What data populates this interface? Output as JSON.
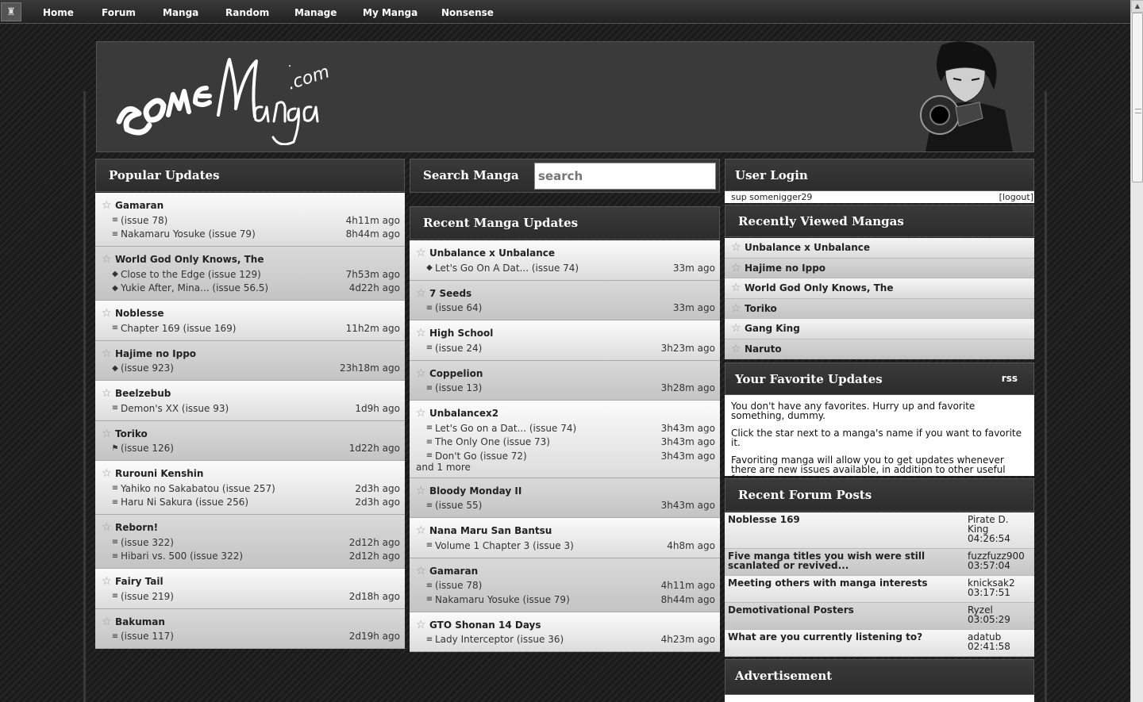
{
  "nav": {
    "items": [
      "Home",
      "Forum",
      "Manga",
      "Random",
      "Manage",
      "My Manga",
      "Nonsense"
    ]
  },
  "brand": {
    "logo_text": "someManga.com"
  },
  "popular": {
    "title": "Popular Updates",
    "entries": [
      {
        "name": "Gamaran",
        "lines": [
          {
            "icon": "book",
            "text": "(issue 78)",
            "ago": "4h11m ago"
          },
          {
            "icon": "book",
            "text": "Nakamaru Yosuke (issue 79)",
            "ago": "8h44m ago"
          }
        ]
      },
      {
        "name": "World God Only Knows, The",
        "lines": [
          {
            "icon": "diamond",
            "text": "Close to the Edge (issue 129)",
            "ago": "7h53m ago"
          },
          {
            "icon": "diamond",
            "text": "Yukie After, Mina... (issue 56.5)",
            "ago": "4d22h ago"
          }
        ]
      },
      {
        "name": "Noblesse",
        "lines": [
          {
            "icon": "book",
            "text": "Chapter 169 (issue 169)",
            "ago": "11h2m ago"
          }
        ]
      },
      {
        "name": "Hajime no Ippo",
        "lines": [
          {
            "icon": "diamond",
            "text": "(issue 923)",
            "ago": "23h18m ago"
          }
        ]
      },
      {
        "name": "Beelzebub",
        "lines": [
          {
            "icon": "book",
            "text": "Demon's XX (issue 93)",
            "ago": "1d9h ago"
          }
        ]
      },
      {
        "name": "Toriko",
        "lines": [
          {
            "icon": "flag",
            "text": "(issue 126)",
            "ago": "1d22h ago"
          }
        ]
      },
      {
        "name": "Rurouni Kenshin",
        "lines": [
          {
            "icon": "book",
            "text": "Yahiko no Sakabatou (issue 257)",
            "ago": "2d3h ago"
          },
          {
            "icon": "book",
            "text": "Haru Ni Sakura (issue 256)",
            "ago": "2d3h ago"
          }
        ]
      },
      {
        "name": "Reborn!",
        "lines": [
          {
            "icon": "book",
            "text": "(issue 322)",
            "ago": "2d12h ago"
          },
          {
            "icon": "book",
            "text": "Hibari vs. 500 (issue 322)",
            "ago": "2d12h ago"
          }
        ]
      },
      {
        "name": "Fairy Tail",
        "lines": [
          {
            "icon": "book",
            "text": "(issue 219)",
            "ago": "2d18h ago"
          }
        ]
      },
      {
        "name": "Bakuman",
        "lines": [
          {
            "icon": "book",
            "text": "(issue 117)",
            "ago": "2d19h ago"
          }
        ]
      }
    ]
  },
  "search": {
    "title": "Search Manga",
    "placeholder": "search"
  },
  "recent": {
    "title": "Recent Manga Updates",
    "entries": [
      {
        "name": "Unbalance x Unbalance",
        "lines": [
          {
            "icon": "diamond",
            "text": "Let's Go On A Dat... (issue 74)",
            "ago": "33m ago"
          }
        ]
      },
      {
        "name": "7 Seeds",
        "lines": [
          {
            "icon": "book",
            "text": "(issue 64)",
            "ago": "33m ago"
          }
        ]
      },
      {
        "name": "High School",
        "lines": [
          {
            "icon": "book",
            "text": "(issue 24)",
            "ago": "3h23m ago"
          }
        ]
      },
      {
        "name": "Coppelion",
        "lines": [
          {
            "icon": "book",
            "text": "(issue 13)",
            "ago": "3h28m ago"
          }
        ]
      },
      {
        "name": "Unbalancex2",
        "lines": [
          {
            "icon": "book",
            "text": "Let's Go on a Dat... (issue 74)",
            "ago": "3h43m ago"
          },
          {
            "icon": "book",
            "text": "The Only One (issue 73)",
            "ago": "3h43m ago"
          },
          {
            "icon": "book",
            "text": "Don't Go (issue 72)",
            "ago": "3h43m ago"
          }
        ],
        "more": "and 1 more"
      },
      {
        "name": "Bloody Monday II",
        "lines": [
          {
            "icon": "book",
            "text": "(issue 55)",
            "ago": "3h43m ago"
          }
        ]
      },
      {
        "name": "Nana Maru San Bantsu",
        "lines": [
          {
            "icon": "book",
            "text": "Volume 1 Chapter 3 (issue 3)",
            "ago": "4h8m ago"
          }
        ]
      },
      {
        "name": "Gamaran",
        "lines": [
          {
            "icon": "book",
            "text": "(issue 78)",
            "ago": "4h11m ago"
          },
          {
            "icon": "book",
            "text": "Nakamaru Yosuke (issue 79)",
            "ago": "8h44m ago"
          }
        ]
      },
      {
        "name": "GTO Shonan 14 Days",
        "lines": [
          {
            "icon": "book",
            "text": "Lady Interceptor (issue 36)",
            "ago": "4h23m ago"
          }
        ]
      }
    ]
  },
  "login": {
    "title": "User Login",
    "greeting": "sup somenigger29",
    "logout": "[logout]"
  },
  "recently_viewed": {
    "title": "Recently Viewed Mangas",
    "items": [
      "Unbalance x Unbalance",
      "Hajime no Ippo",
      "World God Only Knows, The",
      "Toriko",
      "Gang King",
      "Naruto"
    ]
  },
  "favorites": {
    "title": "Your Favorite Updates",
    "rss": "rss",
    "paragraphs": [
      "You don't have any favorites. Hurry up and favorite something, dummy.",
      "Click the star next to a manga's name if you want to favorite it.",
      "Favoriting manga will allow you to get updates whenever there are new issues available, in addition to other useful features."
    ]
  },
  "forum": {
    "title": "Recent Forum Posts",
    "posts": [
      {
        "title": "Noblesse 169",
        "author": "Pirate D. King",
        "time": "04:26:54"
      },
      {
        "title": "Five manga titles you wish were still scanlated or revived...",
        "author": "fuzzfuzz900",
        "time": "03:57:04"
      },
      {
        "title": "Meeting others with manga interests",
        "author": "knicksak2",
        "time": "03:17:51"
      },
      {
        "title": "Demotivational Posters",
        "author": "Ryzel",
        "time": "03:05:29"
      },
      {
        "title": "What are you currently listening to?",
        "author": "adatub",
        "time": "02:41:58"
      }
    ]
  },
  "advertisement": {
    "title": "Advertisement"
  }
}
